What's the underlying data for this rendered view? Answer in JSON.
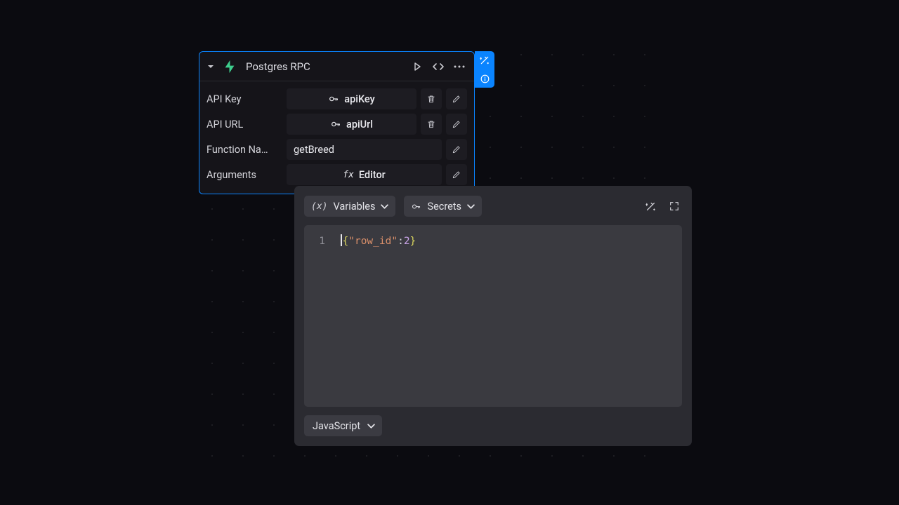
{
  "node": {
    "title": "Postgres RPC",
    "fields": [
      {
        "label": "API Key",
        "value": "apiKey",
        "icon": "key",
        "deletable": true
      },
      {
        "label": "API URL",
        "value": "apiUrl",
        "icon": "key",
        "deletable": true
      },
      {
        "label": "Function Na…",
        "value": "getBreed",
        "icon": null,
        "deletable": false
      },
      {
        "label": "Arguments",
        "value": "Editor",
        "icon": "fx",
        "deletable": false
      }
    ]
  },
  "editor": {
    "pills": {
      "variables": "Variables",
      "secrets": "Secrets"
    },
    "code": {
      "line_number": "1",
      "tokens": {
        "open": "{",
        "key": "\"row_id\"",
        "colon": ":",
        "value": "2",
        "close": "}"
      }
    },
    "language": "JavaScript"
  }
}
